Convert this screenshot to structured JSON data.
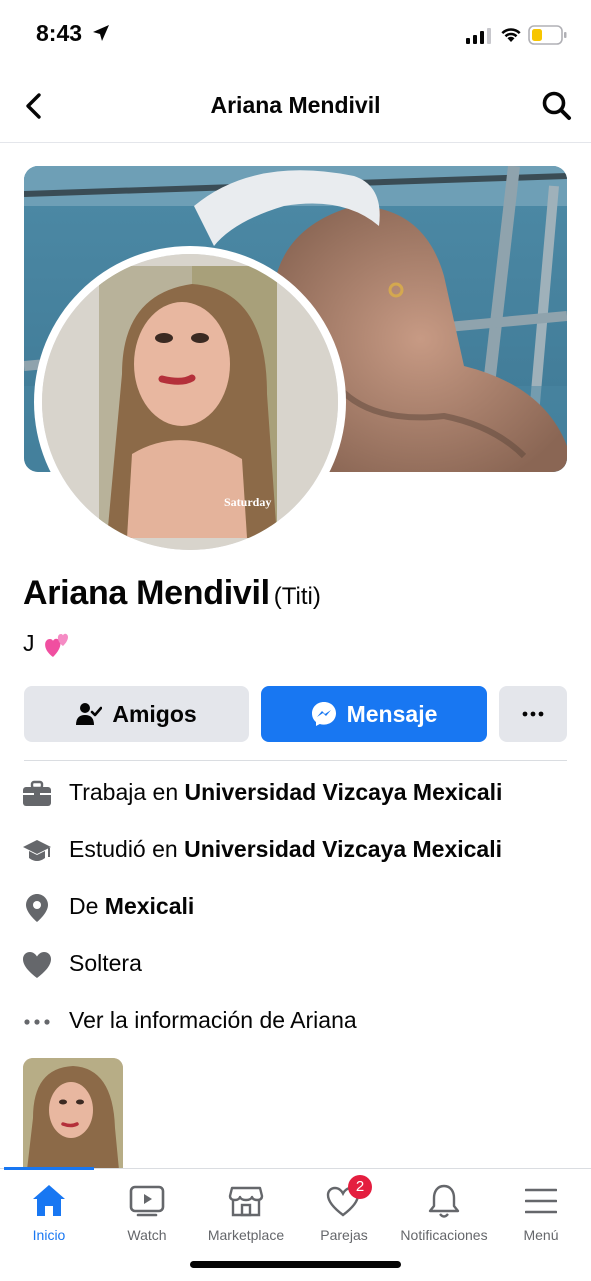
{
  "status_bar": {
    "time": "8:43"
  },
  "header": {
    "title": "Ariana Mendivil"
  },
  "profile": {
    "name": "Ariana Mendivil",
    "nickname": "(Titi)",
    "bio": "J",
    "avatar_watermark": "Saturday"
  },
  "actions": {
    "friends_label": "Amigos",
    "message_label": "Mensaje"
  },
  "info": [
    {
      "prefix": "Trabaja en ",
      "value": "Universidad Vizcaya Mexicali",
      "icon": "briefcase-icon"
    },
    {
      "prefix": "Estudió en ",
      "value": "Universidad Vizcaya Mexicali",
      "icon": "graduation-cap-icon"
    },
    {
      "prefix": "De ",
      "value": "Mexicali",
      "icon": "location-pin-icon"
    },
    {
      "prefix": "",
      "value": "Soltera",
      "icon": "heart-icon"
    },
    {
      "prefix": "",
      "value": "Ver la información de Ariana",
      "icon": "more-dots-icon"
    }
  ],
  "tabs": [
    {
      "label": "Inicio",
      "icon": "home-icon",
      "active": true
    },
    {
      "label": "Watch",
      "icon": "watch-icon"
    },
    {
      "label": "Marketplace",
      "icon": "marketplace-icon"
    },
    {
      "label": "Parejas",
      "icon": "dating-icon",
      "badge": "2"
    },
    {
      "label": "Notificaciones",
      "icon": "bell-icon"
    },
    {
      "label": "Menú",
      "icon": "menu-icon"
    }
  ],
  "colors": {
    "accent": "#1877f2",
    "badge": "#e41e3f",
    "button_gray": "#e4e6eb",
    "icon_gray": "#65676b"
  }
}
